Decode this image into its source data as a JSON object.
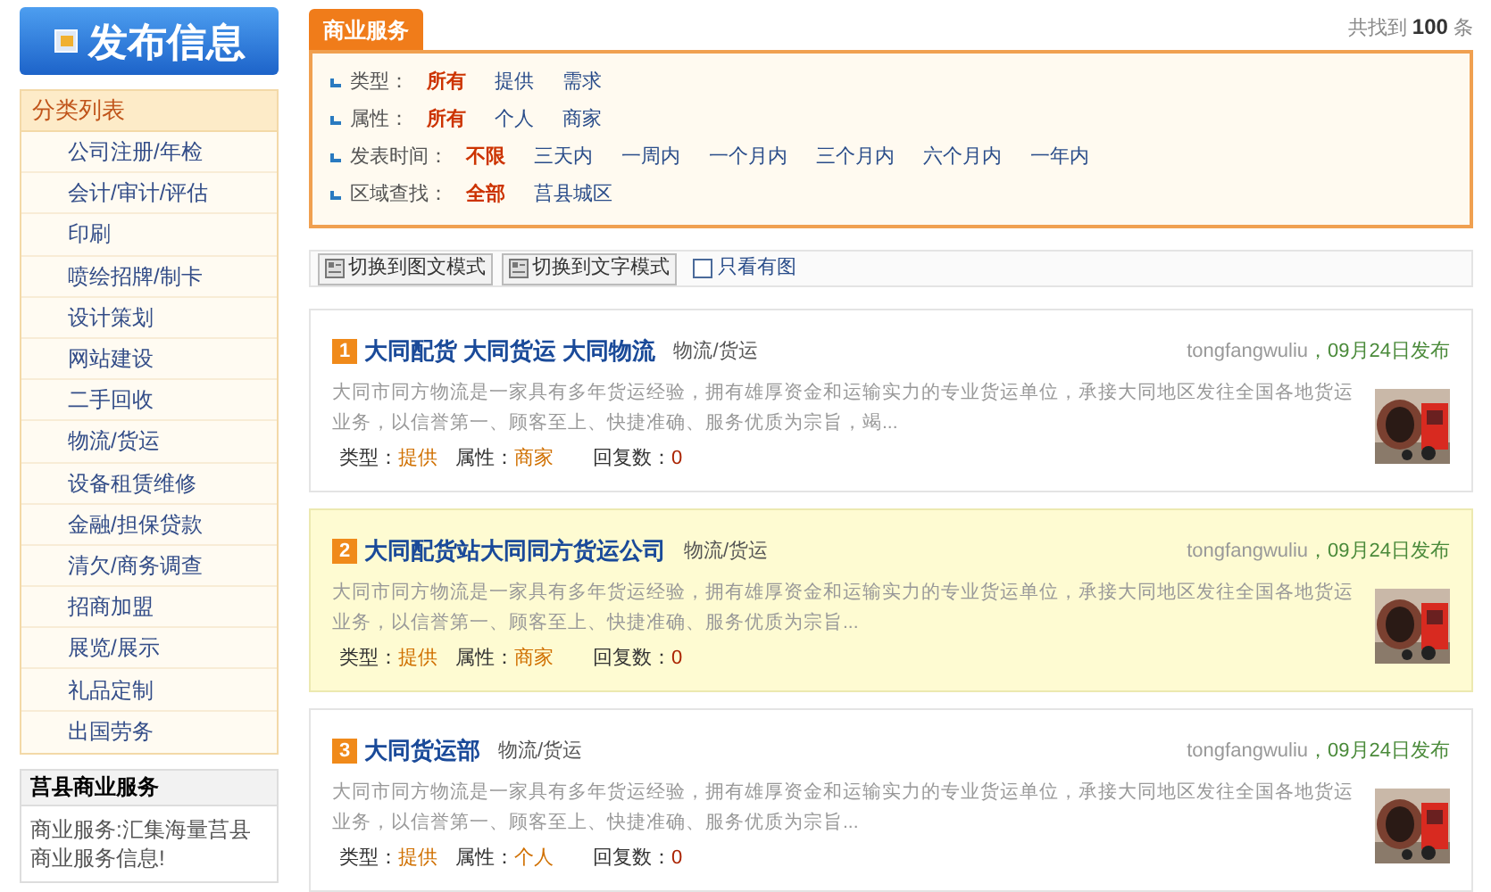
{
  "publish_button": {
    "label": "发布信息"
  },
  "category_panel": {
    "title": "分类列表",
    "items": [
      "公司注册/年检",
      "会计/审计/评估",
      "印刷",
      "喷绘招牌/制卡",
      "设计策划",
      "网站建设",
      "二手回收",
      "物流/货运",
      "设备租赁维修",
      "金融/担保贷款",
      "清欠/商务调查",
      "招商加盟",
      "展览/展示",
      "礼品定制",
      "出国劳务"
    ]
  },
  "info_box": {
    "title": "莒县商业服务",
    "text": "商业服务:汇集海量莒县商业服务信息!"
  },
  "tab": {
    "label": "商业服务"
  },
  "result_count": {
    "prefix": "共找到",
    "count": "100",
    "suffix": "条"
  },
  "filters": [
    {
      "label": "类型：",
      "options": [
        {
          "label": "所有",
          "selected": true
        },
        {
          "label": "提供",
          "selected": false
        },
        {
          "label": "需求",
          "selected": false
        }
      ]
    },
    {
      "label": "属性：",
      "options": [
        {
          "label": "所有",
          "selected": true
        },
        {
          "label": "个人",
          "selected": false
        },
        {
          "label": "商家",
          "selected": false
        }
      ]
    },
    {
      "label": "发表时间：",
      "options": [
        {
          "label": "不限",
          "selected": true
        },
        {
          "label": "三天内",
          "selected": false
        },
        {
          "label": "一周内",
          "selected": false
        },
        {
          "label": "一个月内",
          "selected": false
        },
        {
          "label": "三个月内",
          "selected": false
        },
        {
          "label": "六个月内",
          "selected": false
        },
        {
          "label": "一年内",
          "selected": false
        }
      ]
    },
    {
      "label": "区域查找：",
      "options": [
        {
          "label": "全部",
          "selected": true
        },
        {
          "label": "莒县城区",
          "selected": false
        }
      ]
    }
  ],
  "view_buttons": [
    {
      "label": "切换到图文模式"
    },
    {
      "label": "切换到文字模式"
    }
  ],
  "only_images": {
    "label": "只看有图",
    "checked": false
  },
  "listings": [
    {
      "number": "1",
      "title": "大同配货 大同货运 大同物流",
      "category": "物流/货运",
      "user": "tongfangwuliu",
      "date": "，09月24日发布",
      "description": "大同市同方物流是一家具有多年货运经验，拥有雄厚资金和运输实力的专业货运单位，承接大同地区发往全国各地货运业务，以信誉第一、顾客至上、快捷准确、服务优质为宗旨，竭...",
      "type_label": "类型：",
      "type": "提供",
      "attr_label": "属性：",
      "attr": "商家",
      "replies_label": "回复数：",
      "replies": "0",
      "highlighted": false
    },
    {
      "number": "2",
      "title": "大同配货站大同同方货运公司",
      "category": "物流/货运",
      "user": "tongfangwuliu",
      "date": "，09月24日发布",
      "description": "大同市同方物流是一家具有多年货运经验，拥有雄厚资金和运输实力的专业货运单位，承接大同地区发往全国各地货运业务，以信誉第一、顾客至上、快捷准确、服务优质为宗旨...",
      "type_label": "类型：",
      "type": "提供",
      "attr_label": "属性：",
      "attr": "商家",
      "replies_label": "回复数：",
      "replies": "0",
      "highlighted": true
    },
    {
      "number": "3",
      "title": "大同货运部",
      "category": "物流/货运",
      "user": "tongfangwuliu",
      "date": "，09月24日发布",
      "description": "大同市同方物流是一家具有多年货运经验，拥有雄厚资金和运输实力的专业货运单位，承接大同地区发往全国各地货运业务，以信誉第一、顾客至上、快捷准确、服务优质为宗旨...",
      "type_label": "类型：",
      "type": "提供",
      "attr_label": "属性：",
      "attr": "个人",
      "replies_label": "回复数：",
      "replies": "0",
      "highlighted": false
    }
  ]
}
